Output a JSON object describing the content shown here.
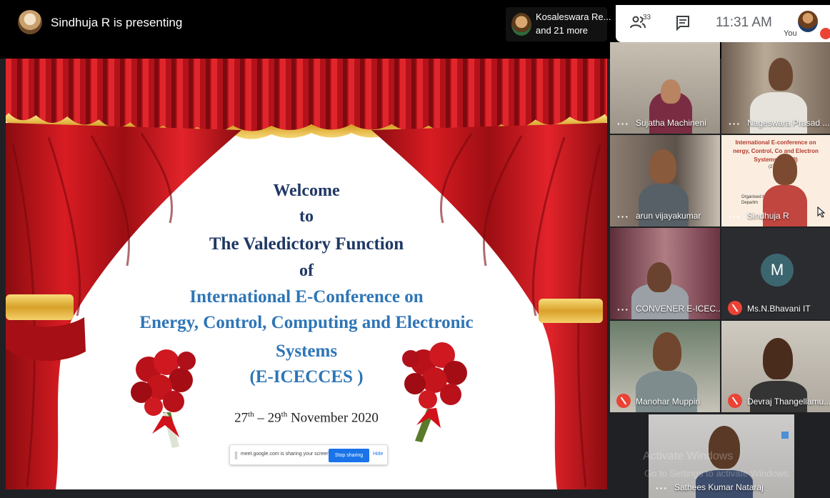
{
  "top_bar": {
    "presenting": "Sindhuja R is presenting",
    "others_name": "Kosaleswara Re...",
    "others_more": "and 21 more",
    "people_count": "33",
    "clock": "11:31 AM",
    "self_label": "You"
  },
  "slide": {
    "line1": "Welcome",
    "line2": "to",
    "line3": "The Valedictory Function",
    "line4": "of",
    "line5": "International E-Conference on",
    "line6": "Energy, Control, Computing and Electronic",
    "line7": "Systems",
    "line8": "(E-ICECCES )",
    "date_start": "27",
    "date_sup1": "th",
    "date_mid": " – 29",
    "date_sup2": "th",
    "date_end": " November 2020"
  },
  "share_bar": {
    "message": "meet.google.com is sharing your screen.",
    "stop_label": "Stop sharing",
    "hide_label": "Hide"
  },
  "tile_slide": {
    "title1": "International E-conference on",
    "title2": "nergy, Control, Co      and Electron",
    "title3": "Systems (E       020)",
    "title4": "(27",
    "organised": "Organised by",
    "dept": "Departm"
  },
  "participants": [
    {
      "name": "Sujatha Machineni",
      "muted": false
    },
    {
      "name": "Nageswara Prasad ...",
      "muted": false
    },
    {
      "name": "arun vijayakumar",
      "muted": false
    },
    {
      "name": "Sindhuja R",
      "muted": false
    },
    {
      "name": "CONVENER E-ICEC...",
      "muted": false
    },
    {
      "name": "Ms.N.Bhavani IT",
      "muted": true,
      "initial": "M"
    },
    {
      "name": "Manohar Muppiri",
      "muted": true
    },
    {
      "name": "Devraj Thangellamu...",
      "muted": true
    },
    {
      "name": "Sathees Kumar Nataraj",
      "muted": false
    }
  ],
  "watermark": {
    "line1": "Activate Windows",
    "line2": "Go to Settings to activate Windows."
  },
  "colors": {
    "curtain": "#c8141b",
    "gold": "#e8b83a",
    "navy": "#1f3864",
    "blue": "#2e75b6",
    "mute_red": "#ea4335",
    "avatar_teal": "#3b6670"
  }
}
